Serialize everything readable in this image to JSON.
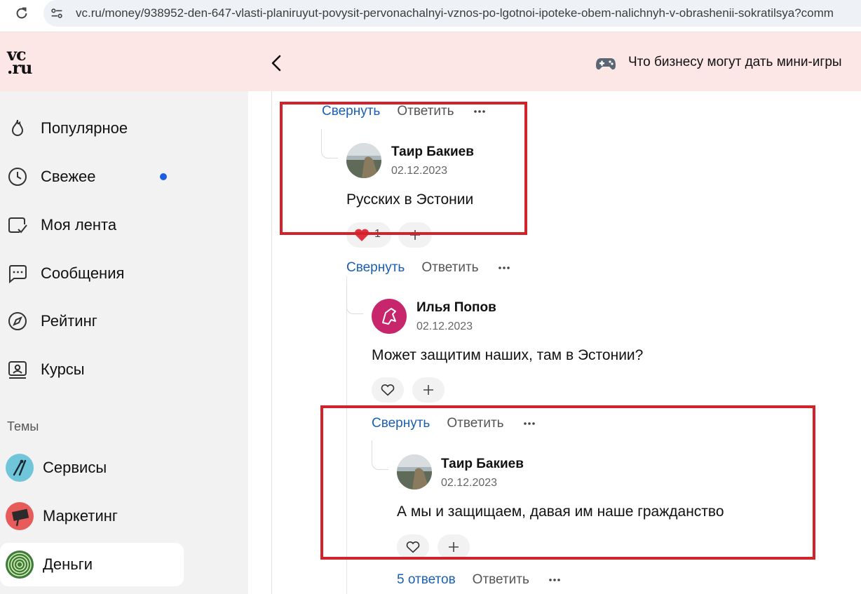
{
  "browser": {
    "url": "vc.ru/money/938952-den-647-vlasti-planiruyut-povysit-pervonachalnyi-vznos-po-lgotnoi-ipoteke-obem-nalichnyh-v-obrashenii-sokratilsya?comm"
  },
  "header": {
    "logo_top": "vc",
    "logo_bottom": ".ru",
    "promo_text": "Что бизнесу могут дать мини-игры"
  },
  "sidebar": {
    "nav": [
      {
        "label": "Популярное",
        "icon": "flame-icon"
      },
      {
        "label": "Свежее",
        "icon": "clock-icon",
        "has_dot": true
      },
      {
        "label": "Моя лента",
        "icon": "feed-check-icon"
      },
      {
        "label": "Сообщения",
        "icon": "chat-icon"
      },
      {
        "label": "Рейтинг",
        "icon": "compass-icon"
      },
      {
        "label": "Курсы",
        "icon": "courses-icon"
      }
    ],
    "themes_heading": "Темы",
    "topics": [
      {
        "label": "Сервисы",
        "color": "#6fc6da"
      },
      {
        "label": "Маркетинг",
        "color": "#e85b5b"
      },
      {
        "label": "Деньги",
        "color": "#3f7d3a",
        "active": true
      }
    ]
  },
  "comments": {
    "actions": {
      "collapse": "Свернуть",
      "reply": "Ответить",
      "replies": "5 ответов"
    },
    "items": [
      {
        "author": "Таир Бакиев",
        "date": "02.12.2023",
        "text": "Русских в Эстонии",
        "likes": "1"
      },
      {
        "author": "Илья Попов",
        "date": "02.12.2023",
        "text": "Может защитим наших, там в Эстонии?"
      },
      {
        "author": "Таир Бакиев",
        "date": "02.12.2023",
        "text": "А мы и защищаем, давая им наше гражданство"
      }
    ]
  },
  "colors": {
    "header_bg": "#fde6e6",
    "link_blue": "#1a5fb4",
    "highlight_red": "#d2232a",
    "sidebar_bg": "#f2f2f2"
  }
}
